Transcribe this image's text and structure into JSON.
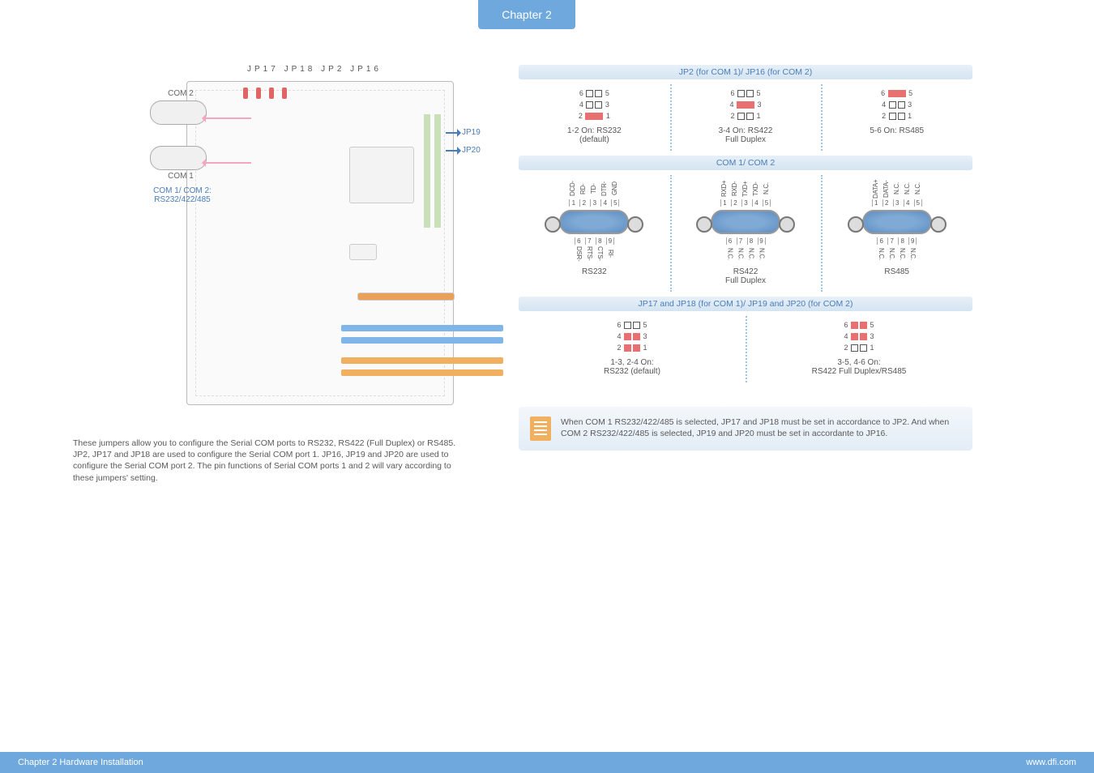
{
  "header": {
    "tab": "Chapter 2"
  },
  "footer": {
    "left": "Chapter 2 Hardware Installation",
    "right": "www.dfi.com"
  },
  "board": {
    "jumper_top_labels": "JP17 JP18  JP2   JP16",
    "com2": "COM 2",
    "com1": "COM 1",
    "com_note_line1": "COM 1/ COM 2:",
    "com_note_line2": "RS232/422/485",
    "jp19": "JP19",
    "jp20": "JP20"
  },
  "desc": "These jumpers allow you to configure the Serial COM ports to RS232, RS422 (Full Duplex) or RS485. JP2, JP17 and JP18 are used to configure the Serial COM port 1. JP16, JP19 and JP20 are used to configure the Serial COM port 2. The pin functions of Serial COM ports 1 and 2 will vary according to these jumpers' setting.",
  "tables": {
    "t1": {
      "title": "JP2 (for COM 1)/ JP16 (for COM 2)",
      "cells": [
        {
          "caption_l1": "1-2 On: RS232",
          "caption_l2": "(default)"
        },
        {
          "caption_l1": "3-4 On: RS422",
          "caption_l2": "Full Duplex"
        },
        {
          "caption_l1": "5-6 On: RS485",
          "caption_l2": ""
        }
      ]
    },
    "t2": {
      "title": "COM 1/ COM 2",
      "cells": [
        {
          "top_pins": [
            "DCD-",
            "RD-",
            "TD-",
            "DTR-",
            "GND"
          ],
          "bot_pins": [
            "DSR-",
            "RTS-",
            "CTS-",
            "RI-"
          ],
          "caption": "RS232"
        },
        {
          "top_pins": [
            "RXD+",
            "RXD-",
            "TXD+",
            "TXD-",
            "N.C."
          ],
          "bot_pins": [
            "N.C.",
            "N.C.",
            "N.C.",
            "N.C."
          ],
          "caption_l1": "RS422",
          "caption_l2": "Full Duplex"
        },
        {
          "top_pins": [
            "DATA+",
            "DATA-",
            "N.C.",
            "N.C.",
            "N.C."
          ],
          "bot_pins": [
            "N.C.",
            "N.C.",
            "N.C.",
            "N.C."
          ],
          "caption": "RS485"
        }
      ]
    },
    "t3": {
      "title": "JP17 and JP18 (for COM 1)/ JP19 and JP20 (for COM 2)",
      "cells": [
        {
          "caption_l1": "1-3, 2-4 On:",
          "caption_l2": "RS232 (default)"
        },
        {
          "caption_l1": "3-5, 4-6 On:",
          "caption_l2": "RS422 Full Duplex/RS485"
        }
      ]
    }
  },
  "serial_nums_top": [
    "1",
    "2",
    "3",
    "4",
    "5"
  ],
  "serial_nums_bot": [
    "6",
    "7",
    "8",
    "9"
  ],
  "jumper_pins": {
    "r1": [
      "6",
      "5"
    ],
    "r2": [
      "4",
      "3"
    ],
    "r3": [
      "2",
      "1"
    ]
  },
  "note": "When COM 1 RS232/422/485 is selected, JP17 and JP18 must be set in accordance to JP2. And when COM 2 RS232/422/485 is selected, JP19 and JP20 must be set in accordante to JP16."
}
